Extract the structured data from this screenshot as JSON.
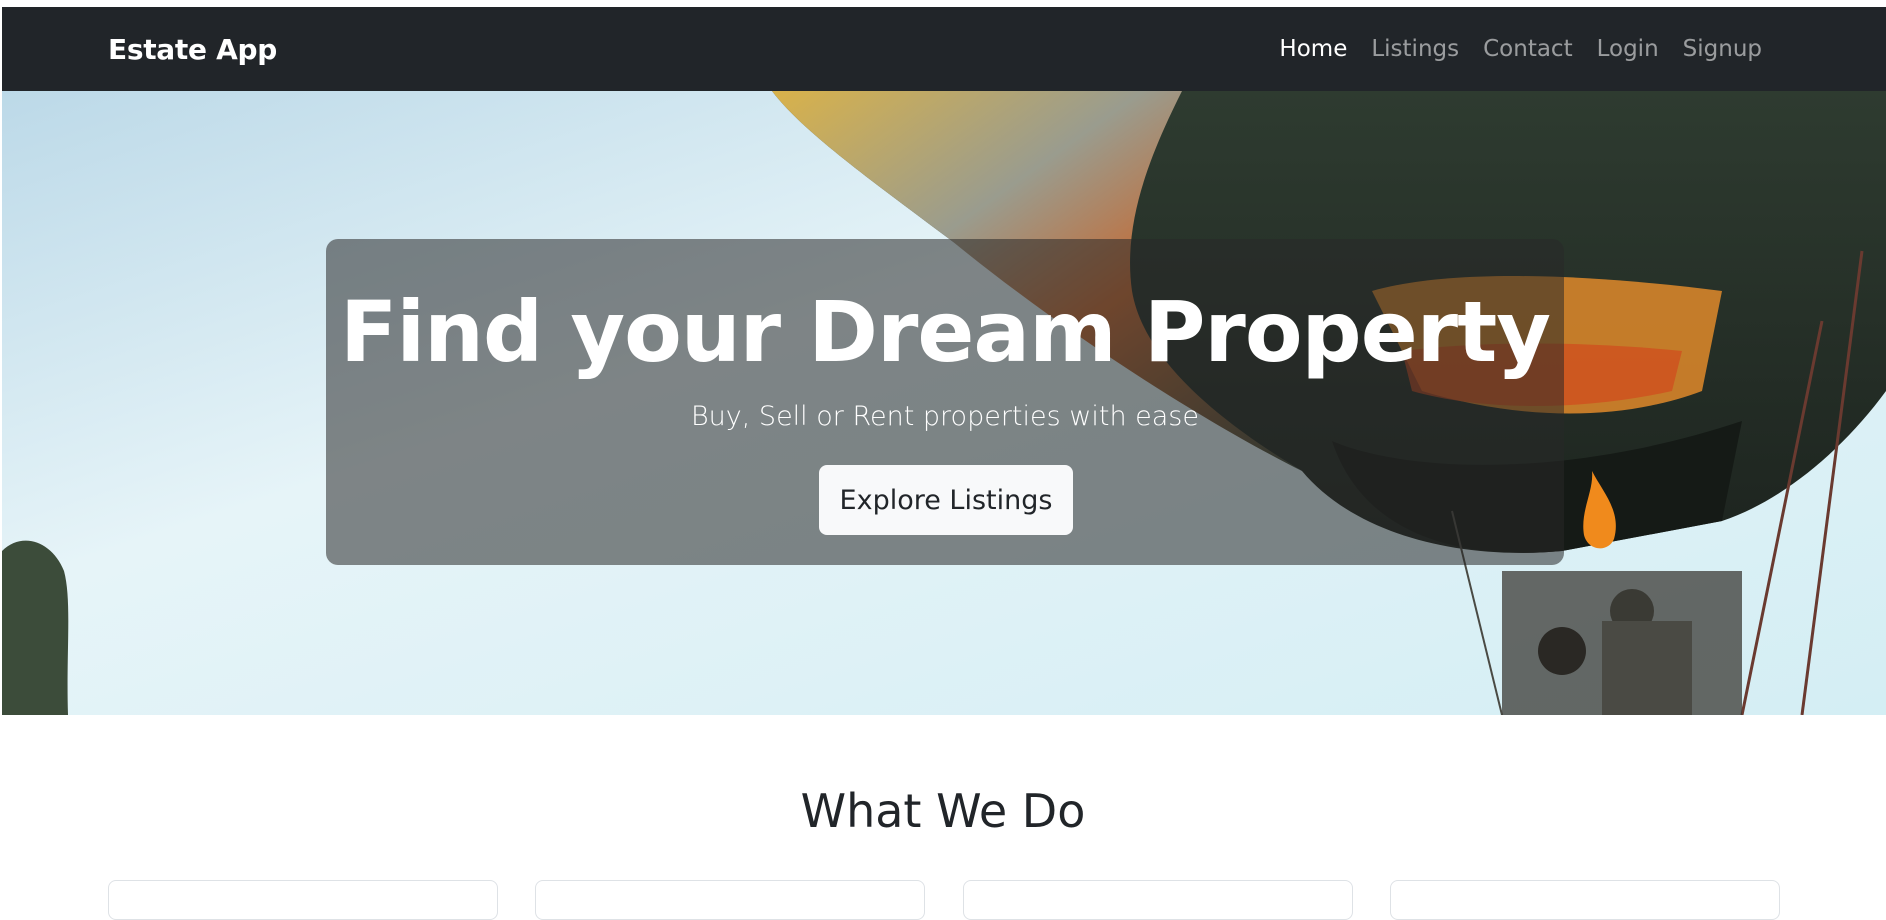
{
  "navbar": {
    "brand": "Estate App",
    "links": [
      {
        "label": "Home",
        "active": true
      },
      {
        "label": "Listings",
        "active": false
      },
      {
        "label": "Contact",
        "active": false
      },
      {
        "label": "Login",
        "active": false
      },
      {
        "label": "Signup",
        "active": false
      }
    ]
  },
  "hero": {
    "title": "Find your Dream Property",
    "subtitle": "Buy, Sell or Rent properties with ease",
    "button_label": "Explore Listings"
  },
  "services": {
    "title": "What We Do",
    "card_count": 4
  },
  "colors": {
    "navbar_bg": "#212529",
    "nav_active": "#ffffff",
    "nav_inactive": "#8f9296",
    "button_bg": "#f8f9fa"
  }
}
